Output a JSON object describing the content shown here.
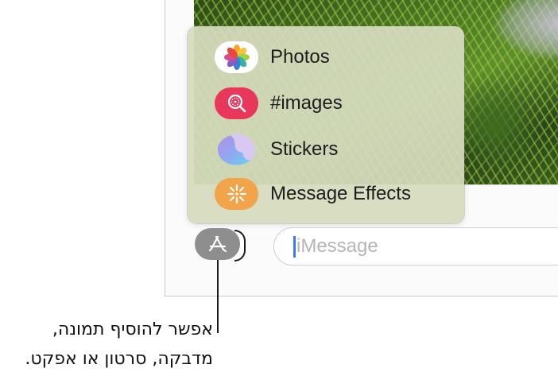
{
  "menu": {
    "items": [
      {
        "label": "Photos",
        "icon": "photos-icon"
      },
      {
        "label": "#images",
        "icon": "images-search-icon"
      },
      {
        "label": "Stickers",
        "icon": "stickers-icon"
      },
      {
        "label": "Message Effects",
        "icon": "message-effects-icon"
      }
    ]
  },
  "composer": {
    "placeholder": "iMessage",
    "apps_button_icon": "app-store-icon"
  },
  "callout": {
    "line1": "אפשר להוסיף תמונה,",
    "line2": "מדבקה, סרטון או אפקט."
  },
  "colors": {
    "images_icon_bg": "#e8375a",
    "effects_icon_bg": "#f2a44a",
    "caret": "#3a7bf5",
    "popup_bg": "#d6dbbe"
  }
}
